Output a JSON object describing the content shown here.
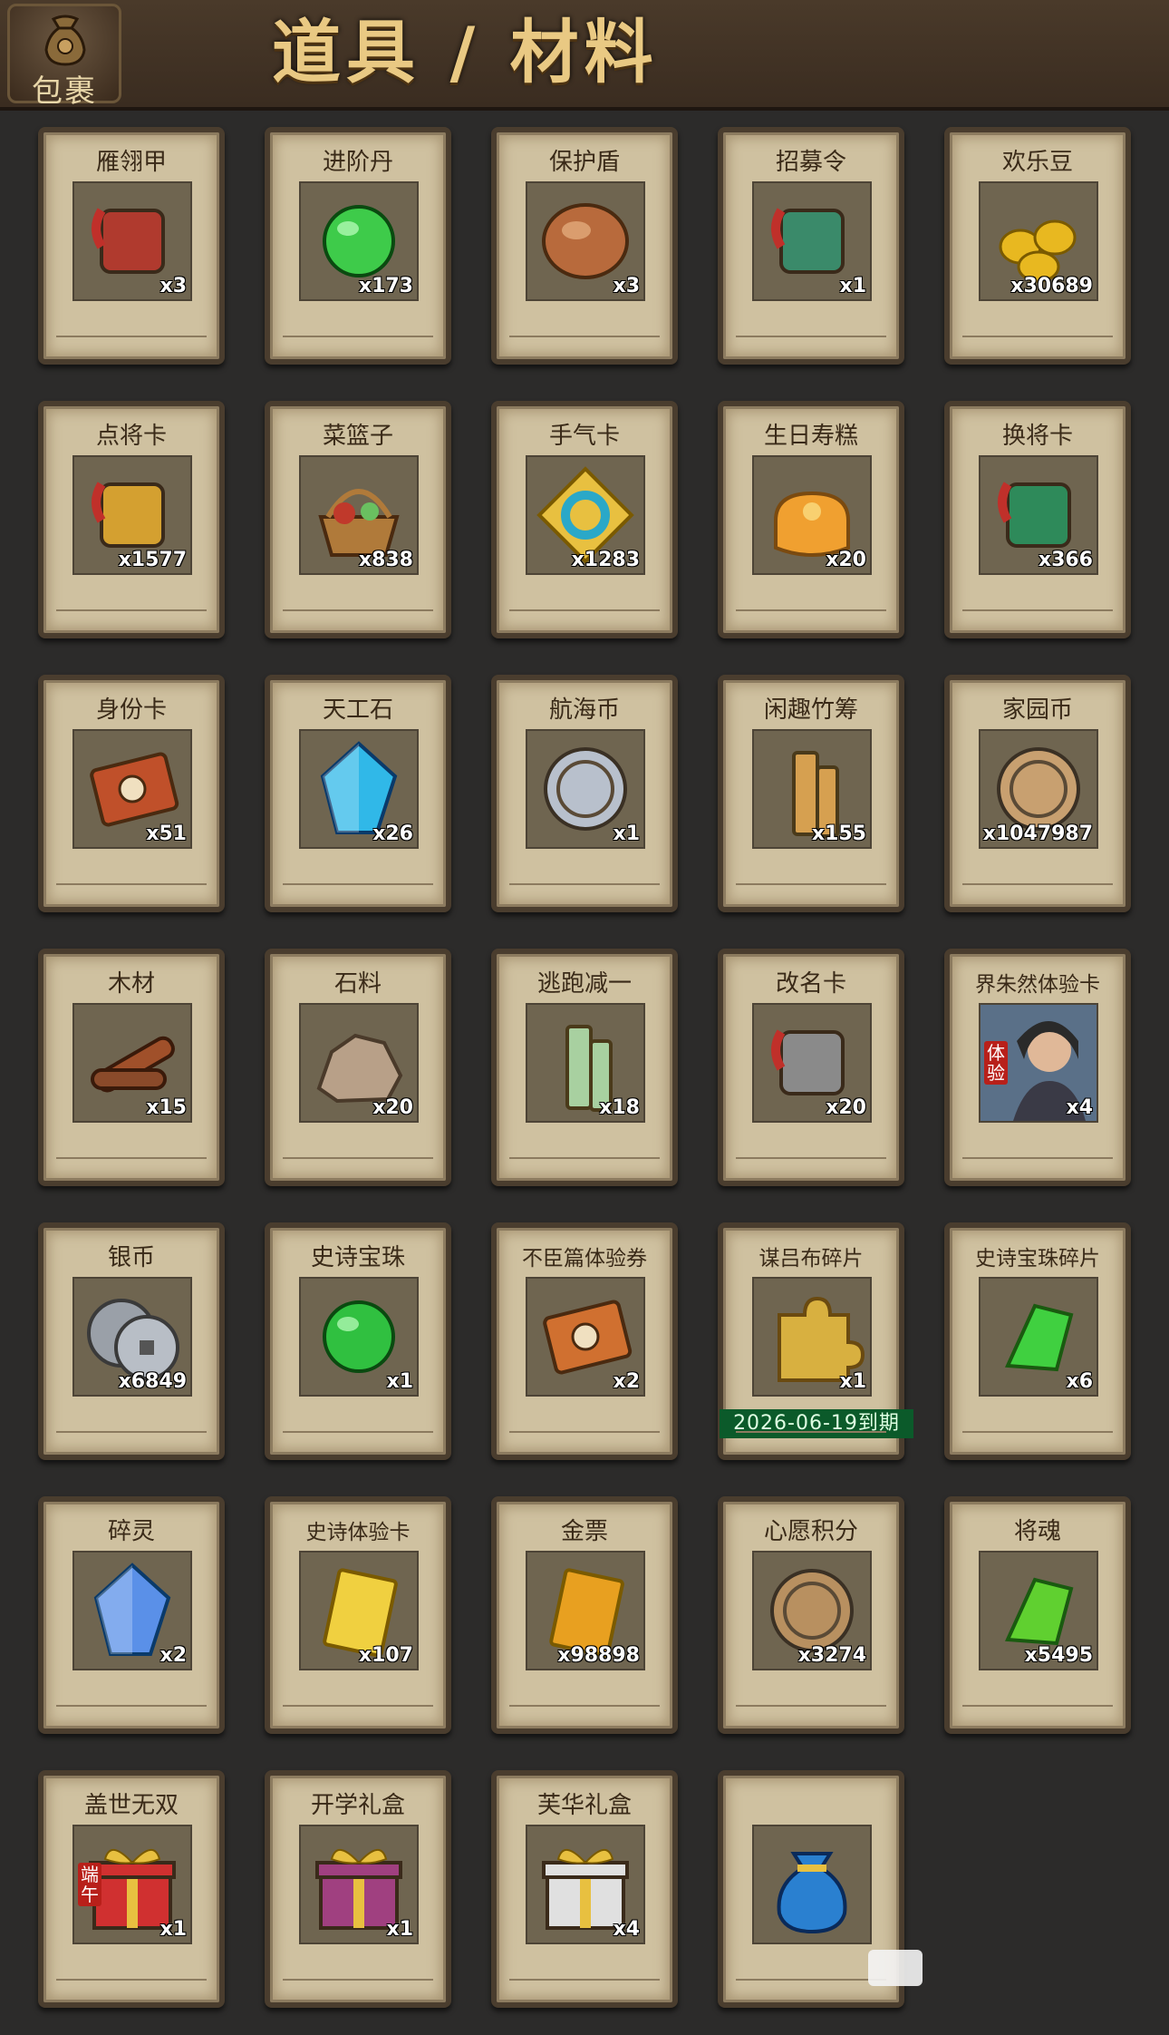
{
  "header": {
    "bag_label": "包裹",
    "title": "道具 / 材料"
  },
  "items": [
    {
      "name": "雁翎甲",
      "count": "x3",
      "icon": "armor-icon",
      "color": "#b03a2e"
    },
    {
      "name": "进阶丹",
      "count": "x173",
      "icon": "green-pill-icon",
      "color": "#3ecb4a"
    },
    {
      "name": "保护盾",
      "count": "x3",
      "icon": "shield-icon",
      "color": "#b86a3c"
    },
    {
      "name": "招募令",
      "count": "x1",
      "icon": "recruit-token-icon",
      "color": "#3a8a6a"
    },
    {
      "name": "欢乐豆",
      "count": "x30689",
      "icon": "gold-beans-icon",
      "color": "#e8b820"
    },
    {
      "name": "点将卡",
      "count": "x1577",
      "icon": "general-card-icon",
      "color": "#d4a030"
    },
    {
      "name": "菜篮子",
      "count": "x838",
      "icon": "basket-icon",
      "color": "#c0392b"
    },
    {
      "name": "手气卡",
      "count": "x1283",
      "icon": "luck-card-icon",
      "color": "#2aa8c8"
    },
    {
      "name": "生日寿糕",
      "count": "x20",
      "icon": "birthday-cake-icon",
      "color": "#f0a030"
    },
    {
      "name": "换将卡",
      "count": "x366",
      "icon": "swap-general-card-icon",
      "color": "#2e8a5a"
    },
    {
      "name": "身份卡",
      "count": "x51",
      "icon": "identity-card-icon",
      "color": "#c0502a"
    },
    {
      "name": "天工石",
      "count": "x26",
      "icon": "blue-crystal-icon",
      "color": "#30b8e8"
    },
    {
      "name": "航海币",
      "count": "x1",
      "icon": "silver-coin-icon",
      "color": "#b8c0cc"
    },
    {
      "name": "闲趣竹筹",
      "count": "x155",
      "icon": "bamboo-slips-icon",
      "color": "#d6a050"
    },
    {
      "name": "家园币",
      "count": "x1047987",
      "icon": "home-coin-icon",
      "color": "#c8a070"
    },
    {
      "name": "木材",
      "count": "x15",
      "icon": "wood-icon",
      "color": "#a0502a"
    },
    {
      "name": "石料",
      "count": "x20",
      "icon": "stone-icon",
      "color": "#b8a088"
    },
    {
      "name": "逃跑减一",
      "count": "x18",
      "icon": "escape-tag-icon",
      "color": "#a8d0a0"
    },
    {
      "name": "改名卡",
      "count": "x20",
      "icon": "rename-card-icon",
      "color": "#8a8a8a"
    },
    {
      "name": "界朱然体验卡",
      "count": "x4",
      "icon": "hero-portrait-icon",
      "color": "#4a6a88",
      "badge": "体验"
    },
    {
      "name": "银币",
      "count": "x6849",
      "icon": "silver-coins-icon",
      "color": "#9aa0a8"
    },
    {
      "name": "史诗宝珠",
      "count": "x1",
      "icon": "epic-orb-icon",
      "color": "#30c040"
    },
    {
      "name": "不臣篇体验券",
      "count": "x2",
      "icon": "ticket-icon",
      "color": "#d07030"
    },
    {
      "name": "谋吕布碎片",
      "count": "x1",
      "icon": "puzzle-piece-icon",
      "color": "#d8b040",
      "expire": "2026-06-19到期"
    },
    {
      "name": "史诗宝珠碎片",
      "count": "x6",
      "icon": "green-shard-icon",
      "color": "#40d040"
    },
    {
      "name": "碎灵",
      "count": "x2",
      "icon": "crystal-puzzle-icon",
      "color": "#5a90e8"
    },
    {
      "name": "史诗体验卡",
      "count": "x107",
      "icon": "gold-card-icon",
      "color": "#f0d040"
    },
    {
      "name": "金票",
      "count": "x98898",
      "icon": "gold-ticket-icon",
      "color": "#e8a020"
    },
    {
      "name": "心愿积分",
      "count": "x3274",
      "icon": "heart-coin-icon",
      "color": "#b89060"
    },
    {
      "name": "将魂",
      "count": "x5495",
      "icon": "general-soul-icon",
      "color": "#60d030"
    },
    {
      "name": "盖世无双",
      "count": "x1",
      "icon": "red-gift-box-icon",
      "color": "#d03030",
      "badge": "端午"
    },
    {
      "name": "开学礼盒",
      "count": "x1",
      "icon": "purple-gift-box-icon",
      "color": "#a04080"
    },
    {
      "name": "芙华礼盒",
      "count": "x4",
      "icon": "white-gift-box-icon",
      "color": "#e0e0e0"
    },
    {
      "name": "",
      "count": "",
      "icon": "blue-pouch-icon",
      "color": "#2a80d0"
    }
  ]
}
